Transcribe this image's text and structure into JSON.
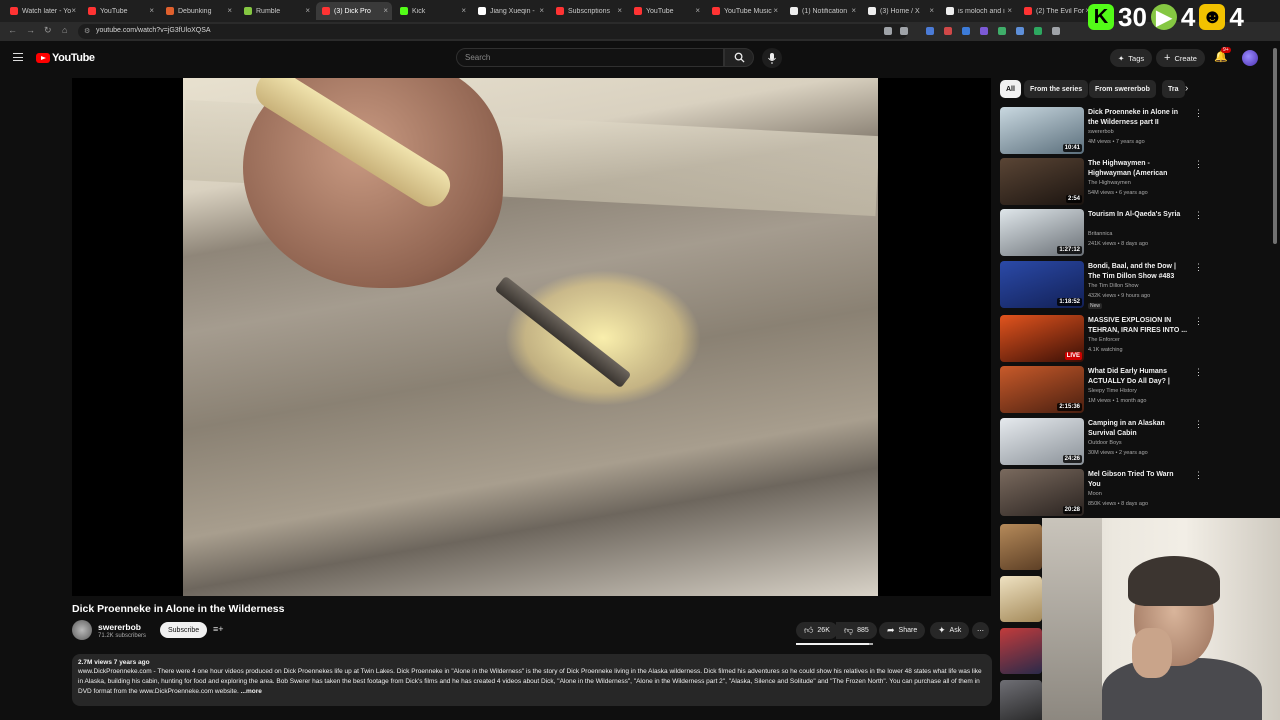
{
  "browser": {
    "tabs": [
      {
        "label": "Watch later - Yo",
        "color": "#ff3333"
      },
      {
        "label": "YouTube",
        "color": "#ff3333"
      },
      {
        "label": "Debunking",
        "color": "#e0602d"
      },
      {
        "label": "Rumble",
        "color": "#85c742"
      },
      {
        "label": "(3) Dick Pro",
        "color": "#ff3333",
        "active": true
      },
      {
        "label": "Kick",
        "color": "#53fc18"
      },
      {
        "label": "Jiang Xueqin -",
        "color": "#ffffff"
      },
      {
        "label": "Subscriptions",
        "color": "#ff3333"
      },
      {
        "label": "YouTube",
        "color": "#ff3333"
      },
      {
        "label": "YouTube Music",
        "color": "#ff3333"
      },
      {
        "label": "(1) Notification",
        "color": "#eeeeee"
      },
      {
        "label": "(3) Home / X",
        "color": "#eeeeee"
      },
      {
        "label": "is moloch and i",
        "color": "#eeeeee"
      },
      {
        "label": "(2) The Evil For",
        "color": "#ff3333"
      }
    ],
    "url": "youtube.com/watch?v=jG3fUloXQSA"
  },
  "overlay": {
    "kick_count": "30",
    "rumble_count": "4",
    "viewer_count": "4",
    "colors": {
      "kick": "#53fc18",
      "rumble": "#85c742",
      "viewer": "#f2c200"
    }
  },
  "header": {
    "logo_text": "YouTube",
    "search_placeholder": "Search",
    "tags_label": "Tags",
    "create_label": "Create",
    "notification_count": "9+"
  },
  "video": {
    "title": "Dick Proenneke in Alone in the Wilderness",
    "channel": "swererbob",
    "subscribers": "71.2K subscribers",
    "subscribe_label": "Subscribe",
    "likes": "26K",
    "dislikes": "885",
    "like_ratio": 0.95,
    "share_label": "Share",
    "ask_label": "Ask",
    "views_age": "2.7M views  7 years ago",
    "description": "www.DickProenneke.com - There were 4 one hour videos produced on Dick Proennekes life up at Twin Lakes. Dick Proenneke in \"Alone in the Wilderness\" is the story of Dick Proenneke living in the Alaska wilderness. Dick filmed his adventures so he could show his relatives in the lower 48 states what life was like in Alaska, building his cabin, hunting for food and exploring the area. Bob Swerer has taken the best footage from Dick's films and he has created 4 videos about Dick, \"Alone in the Wilderness\", \"Alone in the Wilderness part 2\", \"Alaska, Silence and Solitude\" and \"The Frozen North\". You can purchase all of them in DVD format from the www.DickProenneke.com website.",
    "more_label": "...more"
  },
  "sidebar": {
    "chips": [
      "All",
      "From the series",
      "From swererbob",
      "Tra"
    ],
    "recommendations": [
      {
        "title": "Dick Proenneke in Alone in the Wilderness part II",
        "channel": "swererbob",
        "meta": "4M views • 7 years ago",
        "duration": "10:41",
        "colors": [
          "#c9d8e0",
          "#5b6f7c"
        ]
      },
      {
        "title": "The Highwaymen - Highwayman (American Outlaws: Live at ...",
        "channel": "The Highwaymen",
        "meta": "54M views • 6 years ago",
        "duration": "2:54",
        "colors": [
          "#5a4535",
          "#1b1410"
        ]
      },
      {
        "title": "Tourism In Al-Qaeda's Syria",
        "channel": "Britannica",
        "meta": "241K views • 8 days ago",
        "duration": "1:27:12",
        "colors": [
          "#dfe6ea",
          "#6a7076"
        ]
      },
      {
        "title": "Bondi, Baal, and the Dow | The Tim Dillon Show #483",
        "channel": "The Tim Dillon Show",
        "meta": "432K views • 9 hours ago",
        "duration": "1:18:52",
        "badge": "New",
        "colors": [
          "#2b4aa8",
          "#122056"
        ]
      },
      {
        "title": "MASSIVE EXPLOSION IN TEHRAN, IRAN FIRES INTO ...",
        "channel": "The Enforcer",
        "meta": "4.1K watching",
        "duration": "LIVE",
        "live": true,
        "colors": [
          "#e2541e",
          "#3b0f06"
        ]
      },
      {
        "title": "What Did Early Humans ACTUALLY Do All Day? | Histor...",
        "channel": "Sleepy Time History",
        "meta": "1M views • 1 month ago",
        "duration": "2:15:36",
        "colors": [
          "#c85a2a",
          "#4a1f10"
        ]
      },
      {
        "title": "Camping in an Alaskan Survival Cabin",
        "channel": "Outdoor Boys",
        "meta": "30M views • 2 years ago",
        "duration": "24:26",
        "colors": [
          "#e6eaee",
          "#8a9198"
        ]
      },
      {
        "title": "Mel Gibson Tried To Warn You",
        "channel": "Moon",
        "meta": "850K views • 8 days ago",
        "duration": "20:28",
        "colors": [
          "#7a6a5e",
          "#2a2320"
        ]
      }
    ]
  }
}
